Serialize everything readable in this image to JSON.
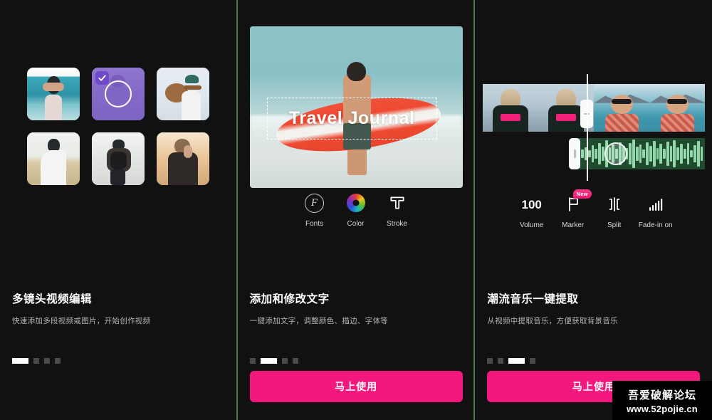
{
  "app": {
    "background": "#111111",
    "divider_color": "#4c7a4c",
    "accent_pink": "#f4187e",
    "accent_purple": "#6e49c8"
  },
  "panels": [
    {
      "id": "panel-multi-clip",
      "title": "多镜头视频编辑",
      "subtitle": "快速添加多段视频或图片，开始创作视频",
      "dots": {
        "count": 4,
        "active_index": 0
      },
      "cta_label": "",
      "gallery": {
        "selected_index": 1,
        "check_icon": "check-icon",
        "items": [
          {
            "name": "thumbnail-beach-dance",
            "art": "art-beach"
          },
          {
            "name": "thumbnail-couple-selected",
            "art": "art-purple"
          },
          {
            "name": "thumbnail-guitar-walk",
            "art": "art-guitar"
          },
          {
            "name": "thumbnail-field-dress",
            "art": "art-field"
          },
          {
            "name": "thumbnail-backpack-snow",
            "art": "art-snow"
          },
          {
            "name": "thumbnail-golden-hour",
            "art": "art-golden"
          }
        ]
      }
    },
    {
      "id": "panel-text-editing",
      "title": "添加和修改文字",
      "subtitle": "一键添加文字，调整颜色、描边、字体等",
      "dots": {
        "count": 4,
        "active_index": 1
      },
      "cta_label": "马上使用",
      "preview": {
        "overlay_text": "Travel Journal",
        "scene": "surfer-carrying-board"
      },
      "toolbar": [
        {
          "name": "fonts-tool",
          "icon": "fonts-icon",
          "glyph": "F",
          "label": "Fonts"
        },
        {
          "name": "color-tool",
          "icon": "color-wheel-icon",
          "label": "Color"
        },
        {
          "name": "stroke-tool",
          "icon": "stroke-t-icon",
          "label": "Stroke"
        }
      ]
    },
    {
      "id": "panel-music-extract",
      "title": "潮流音乐一键提取",
      "subtitle": "从视频中提取音乐，方便获取背景音乐",
      "dots": {
        "count": 4,
        "active_index": 2
      },
      "cta_label": "马上使用",
      "timeline": {
        "video_track_frames": 4,
        "audio_track": "waveform",
        "playhead": true
      },
      "toolbar": [
        {
          "name": "volume-tool",
          "icon": "volume-number-icon",
          "value": "100",
          "label": "Volume"
        },
        {
          "name": "marker-tool",
          "icon": "flag-icon",
          "label": "Marker",
          "badge": "New"
        },
        {
          "name": "split-tool",
          "icon": "split-icon",
          "label": "Split"
        },
        {
          "name": "fade-in-tool",
          "icon": "fade-bars-icon",
          "label": "Fade-in on"
        }
      ]
    }
  ],
  "watermark": {
    "line1": "吾爱破解论坛",
    "line2": "www.52pojie.cn"
  }
}
